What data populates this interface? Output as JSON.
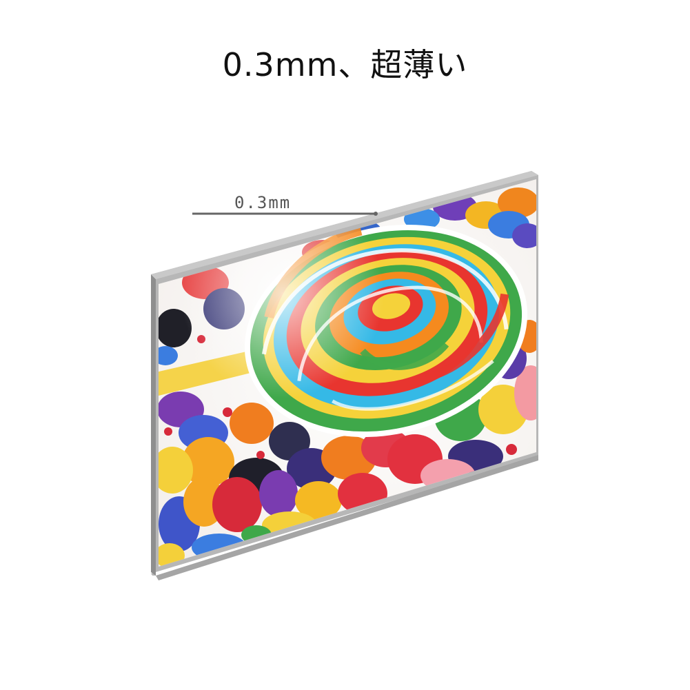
{
  "headline": "0.3mm、超薄い",
  "thickness_label": "0.3mm",
  "colors": {
    "panel_edge": "#9a9a9a",
    "measure_line": "#666666",
    "background": "#ffffff"
  }
}
